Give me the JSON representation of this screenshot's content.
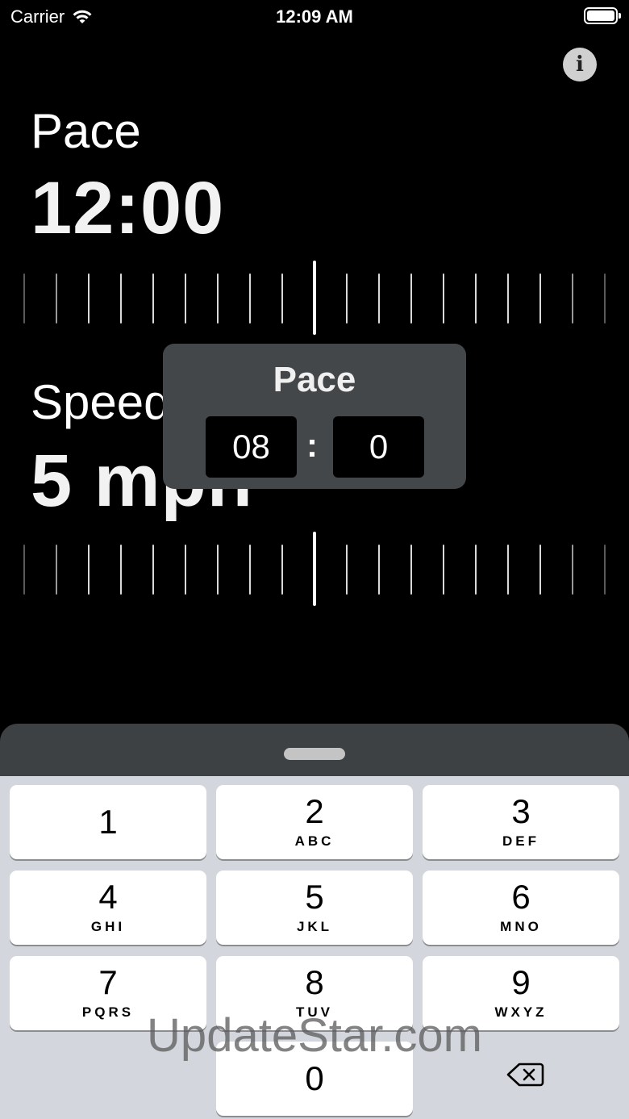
{
  "status_bar": {
    "carrier": "Carrier",
    "time": "12:09 AM"
  },
  "info_button": {
    "label": "i"
  },
  "pace": {
    "label": "Pace",
    "value": "12:00"
  },
  "speed": {
    "label": "Speed",
    "value": "5 mph"
  },
  "popup": {
    "title": "Pace",
    "minutes": "08",
    "separator": ":",
    "seconds": "0"
  },
  "keypad": {
    "keys": [
      {
        "digit": "1",
        "letters": ""
      },
      {
        "digit": "2",
        "letters": "ABC"
      },
      {
        "digit": "3",
        "letters": "DEF"
      },
      {
        "digit": "4",
        "letters": "GHI"
      },
      {
        "digit": "5",
        "letters": "JKL"
      },
      {
        "digit": "6",
        "letters": "MNO"
      },
      {
        "digit": "7",
        "letters": "PQRS"
      },
      {
        "digit": "8",
        "letters": "TUV"
      },
      {
        "digit": "9",
        "letters": "WXYZ"
      },
      {
        "digit": "0",
        "letters": ""
      }
    ],
    "delete_icon": "backspace-icon"
  },
  "watermark": "UpdateStar.com"
}
